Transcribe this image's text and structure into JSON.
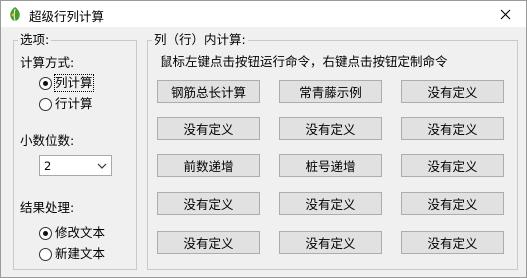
{
  "window": {
    "title": "超级行列计算"
  },
  "options": {
    "group_title": "选项:",
    "calc_mode": {
      "label": "计算方式:",
      "options": [
        "列计算",
        "行计算"
      ],
      "selected": "列计算"
    },
    "decimals": {
      "label": "小数位数:",
      "value": "2"
    },
    "result": {
      "label": "结果处理:",
      "options": [
        "修改文本",
        "新建文本"
      ],
      "selected": "修改文本"
    }
  },
  "commands": {
    "group_title": "列（行）内计算:",
    "hint": "鼠标左键点击按钮运行命令，右键点击按钮定制命令",
    "rows": [
      [
        "钢筋总长计算",
        "常青藤示例",
        "没有定义"
      ],
      [
        "没有定义",
        "没有定义",
        "没有定义"
      ],
      [
        "前数递增",
        "桩号递增",
        "没有定义"
      ],
      [
        "没有定义",
        "没有定义",
        "没有定义"
      ],
      [
        "没有定义",
        "没有定义",
        "没有定义"
      ]
    ]
  },
  "icons": {
    "app": "leaf-icon",
    "close": "close-icon",
    "dropdown": "chevron-down-icon"
  },
  "colors": {
    "app_icon": "#4a9b2e",
    "button_face": "#e1e1e1",
    "titlebar": "#ffffff"
  }
}
